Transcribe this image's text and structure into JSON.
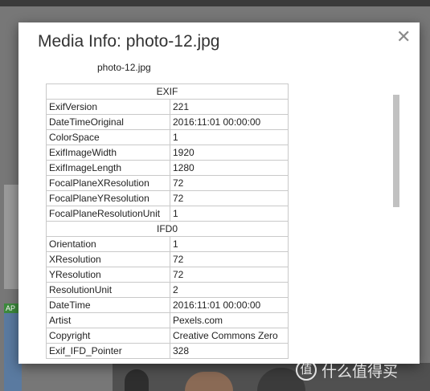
{
  "background": {
    "badge_text": "AP"
  },
  "dialog": {
    "title": "Media Info: photo-12.jpg",
    "close_icon": "close-x-icon",
    "filename": "photo-12.jpg"
  },
  "sections": [
    {
      "heading": "EXIF",
      "rows": [
        {
          "key": "ExifVersion",
          "value": "221"
        },
        {
          "key": "DateTimeOriginal",
          "value": "2016:11:01 00:00:00"
        },
        {
          "key": "ColorSpace",
          "value": "1"
        },
        {
          "key": "ExifImageWidth",
          "value": "1920"
        },
        {
          "key": "ExifImageLength",
          "value": "1280"
        },
        {
          "key": "FocalPlaneXResolution",
          "value": "72"
        },
        {
          "key": "FocalPlaneYResolution",
          "value": "72"
        },
        {
          "key": "FocalPlaneResolutionUnit",
          "value": "1"
        }
      ]
    },
    {
      "heading": "IFD0",
      "rows": [
        {
          "key": "Orientation",
          "value": "1"
        },
        {
          "key": "XResolution",
          "value": "72"
        },
        {
          "key": "YResolution",
          "value": "72"
        },
        {
          "key": "ResolutionUnit",
          "value": "2"
        },
        {
          "key": "DateTime",
          "value": "2016:11:01 00:00:00"
        },
        {
          "key": "Artist",
          "value": "Pexels.com"
        },
        {
          "key": "Copyright",
          "value": "Creative Commons Zero"
        },
        {
          "key": "Exif_IFD_Pointer",
          "value": "328"
        }
      ]
    }
  ],
  "watermark": {
    "logo_glyph": "值",
    "text": "什么值得买"
  }
}
